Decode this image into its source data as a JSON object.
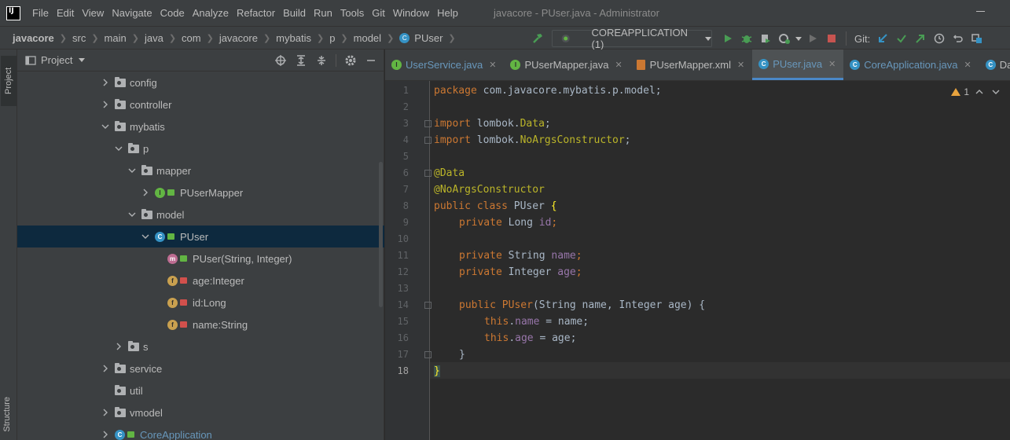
{
  "window": {
    "title": "javacore - PUser.java - Administrator",
    "logo_text": "IJ"
  },
  "menu": [
    "File",
    "Edit",
    "View",
    "Navigate",
    "Code",
    "Analyze",
    "Refactor",
    "Build",
    "Run",
    "Tools",
    "Git",
    "Window",
    "Help"
  ],
  "breadcrumb": [
    "javacore",
    "src",
    "main",
    "java",
    "com",
    "javacore",
    "mybatis",
    "p",
    "model",
    "PUser"
  ],
  "toolbar": {
    "run_config": "COREAPPLICATION (1)",
    "git_label": "Git:"
  },
  "left_stripe": {
    "project": "Project",
    "structure": "Structure"
  },
  "project_panel": {
    "title": "Project",
    "tree": [
      {
        "label": "config",
        "type": "folder",
        "expanded": false
      },
      {
        "label": "controller",
        "type": "folder",
        "expanded": false
      },
      {
        "label": "mybatis",
        "type": "folder",
        "expanded": true
      },
      {
        "label": "p",
        "type": "folder",
        "expanded": true
      },
      {
        "label": "mapper",
        "type": "folder",
        "expanded": true
      },
      {
        "label": "PUserMapper",
        "type": "interface",
        "expanded": false
      },
      {
        "label": "model",
        "type": "folder",
        "expanded": true
      },
      {
        "label": "PUser",
        "type": "class",
        "expanded": true,
        "selected": true
      },
      {
        "label": "PUser(String, Integer)",
        "type": "method"
      },
      {
        "label": "age:Integer",
        "type": "field"
      },
      {
        "label": "id:Long",
        "type": "field"
      },
      {
        "label": "name:String",
        "type": "field"
      },
      {
        "label": "s",
        "type": "folder",
        "expanded": false
      },
      {
        "label": "service",
        "type": "folder",
        "expanded": false
      },
      {
        "label": "util",
        "type": "folder"
      },
      {
        "label": "vmodel",
        "type": "folder",
        "expanded": false
      },
      {
        "label": "CoreApplication",
        "type": "app",
        "expanded": false
      }
    ]
  },
  "editor_tabs": [
    {
      "label": "UserService.java",
      "icon": "I",
      "color": "#6897bb"
    },
    {
      "label": "PUserMapper.java",
      "icon": "I",
      "color": "#bbbbbb"
    },
    {
      "label": "PUserMapper.xml",
      "icon": "xml",
      "color": "#bbbbbb"
    },
    {
      "label": "PUser.java",
      "icon": "C",
      "color": "#6897bb",
      "active": true
    },
    {
      "label": "CoreApplication.java",
      "icon": "C",
      "color": "#6897bb"
    },
    {
      "label": "DataS",
      "icon": "C",
      "color": "#bbbbbb"
    }
  ],
  "inspection": {
    "warnings": "1"
  },
  "code": {
    "line_numbers": [
      "1",
      "2",
      "3",
      "4",
      "5",
      "6",
      "7",
      "8",
      "9",
      "10",
      "11",
      "12",
      "13",
      "14",
      "15",
      "16",
      "17",
      "18"
    ],
    "l1": {
      "kw": "package",
      "rest": " com.javacore.mybatis.p.model;"
    },
    "l3": {
      "kw": "import",
      "pkg": " lombok.",
      "cls": "Data",
      "end": ";"
    },
    "l4": {
      "kw": "import",
      "pkg": " lombok.",
      "cls": "NoArgsConstructor",
      "end": ";"
    },
    "l6": "@Data",
    "l7": "@NoArgsConstructor",
    "l8": {
      "kw": "public class",
      "name": " PUser ",
      "brace": "{"
    },
    "l9": {
      "kw": "private",
      "type": " Long ",
      "field": "id",
      "end": ";"
    },
    "l11": {
      "kw": "private",
      "type": " String ",
      "field": "name",
      "end": ";"
    },
    "l12": {
      "kw": "private",
      "type": " Integer ",
      "field": "age",
      "end": ";"
    },
    "l14": {
      "kw": "public",
      "ctor": " PUser",
      "params": "(String name, Integer age) {"
    },
    "l15": {
      "this": "this",
      "dot": ".",
      "field": "name",
      "rest": " = name;"
    },
    "l16": {
      "this": "this",
      "dot": ".",
      "field": "age",
      "rest": " = age;"
    },
    "l17": "}",
    "l18": "}"
  }
}
